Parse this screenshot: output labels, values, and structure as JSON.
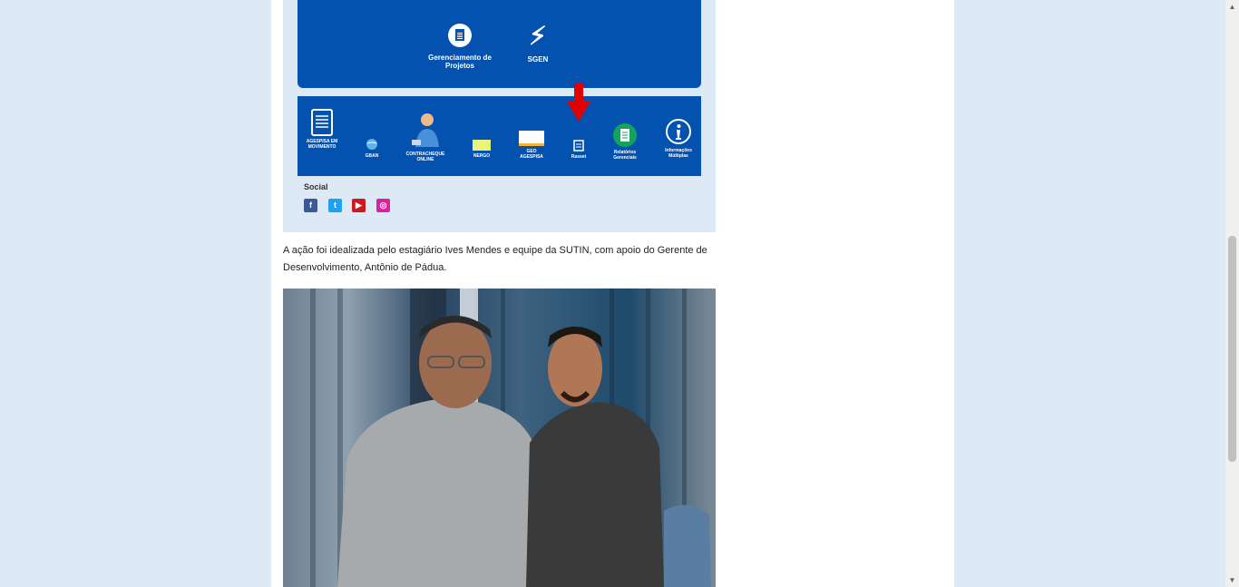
{
  "screenshot": {
    "top_items": [
      {
        "label": "Gerenciamento de Projetos",
        "icon": "document-icon"
      },
      {
        "label": "SGEN",
        "icon": "lightning-icon"
      }
    ],
    "bottom_items": [
      {
        "label": "AGESPISA EM MOVIMENTO",
        "icon": "document-list-icon"
      },
      {
        "label": "GBAN",
        "icon": "globe-icon"
      },
      {
        "label": "CONTRACHEQUE ONLINE",
        "icon": "person-icon"
      },
      {
        "label": "NERGO",
        "icon": "nergo-logo-icon"
      },
      {
        "label": "GEO AGESPISA",
        "icon": "geo-logo-icon"
      },
      {
        "label": "Rasset",
        "icon": "small-doc-icon"
      },
      {
        "label": "Relatórios Gerenciais",
        "icon": "report-icon"
      },
      {
        "label": "Informações Múltiplas",
        "icon": "info-icon"
      }
    ],
    "social_title": "Social",
    "social": [
      {
        "label": "f",
        "icon": "facebook-icon",
        "color": "#3b5998"
      },
      {
        "label": "t",
        "icon": "twitter-icon",
        "color": "#1da1f2"
      },
      {
        "label": "▶",
        "icon": "youtube-icon",
        "color": "#cc181e"
      },
      {
        "label": "◎",
        "icon": "instagram-icon",
        "color": "#d6249f"
      }
    ]
  },
  "article": {
    "caption_line1": "A ação foi idealizada pelo estagiário Ives Mendes e equipe da SUTIN, com apoio do Gerente de",
    "caption_line2": "Desenvolvimento, Antônio de Pádua."
  },
  "colors": {
    "page_bg": "#dde9f5",
    "panel_blue": "#0352b0",
    "arrow_red": "#e00000"
  }
}
